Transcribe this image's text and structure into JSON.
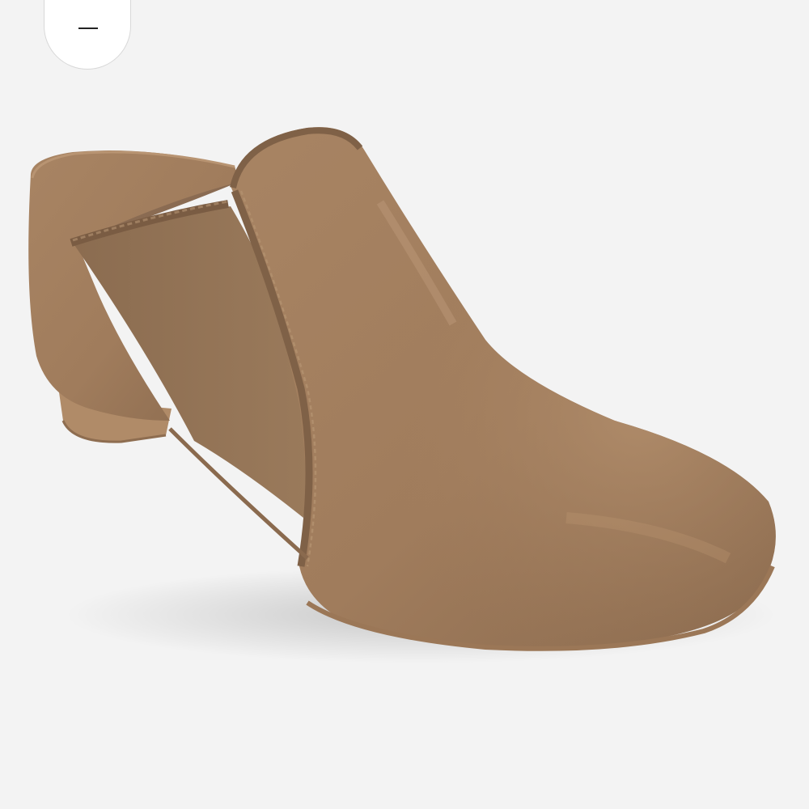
{
  "viewer": {
    "background_color": "#f3f3f3",
    "zoom_control": {
      "icon": "minus-icon"
    },
    "product_image": {
      "subject": "jazz-shoe",
      "colors": {
        "leather": "#a07c5c",
        "leather_shadow": "#7d5f45",
        "leather_highlight": "#b89472",
        "elastic_panel": "#8e6f52",
        "sole": "#b08b68"
      }
    }
  }
}
